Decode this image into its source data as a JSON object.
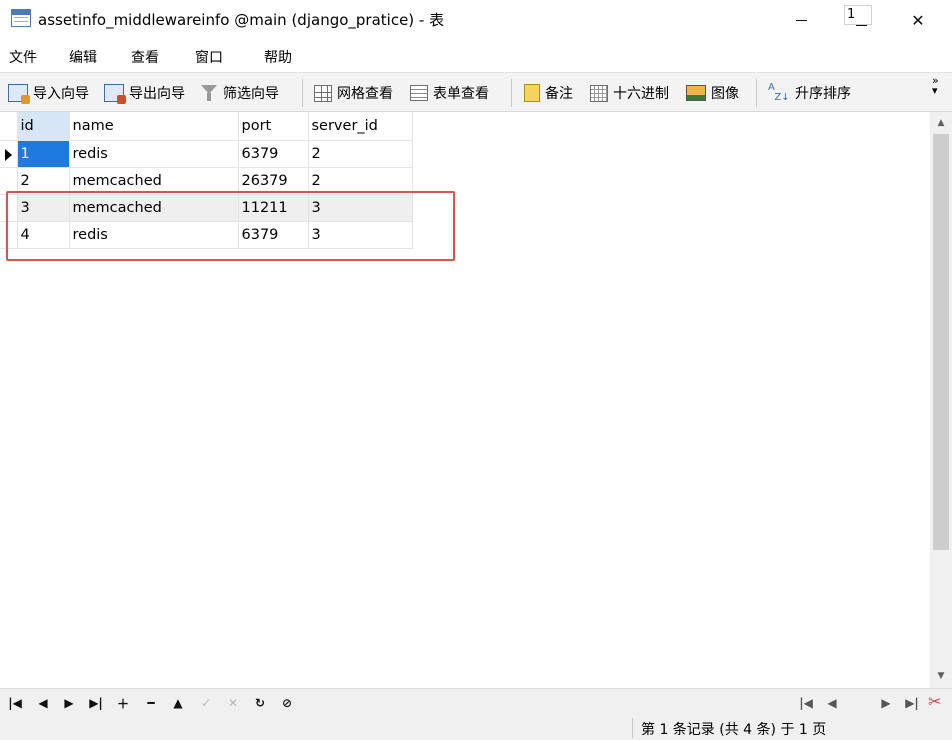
{
  "window": {
    "title": "assetinfo_middlewareinfo @main (django_pratice) - 表"
  },
  "menu": [
    "文件",
    "编辑",
    "查看",
    "窗口",
    "帮助"
  ],
  "toolbar": {
    "import_wizard": "导入向导",
    "export_wizard": "导出向导",
    "filter_wizard": "筛选向导",
    "grid_view": "网格查看",
    "form_view": "表单查看",
    "memo": "备注",
    "hex": "十六进制",
    "image": "图像",
    "sort_asc": "升序排序"
  },
  "table": {
    "columns": [
      "id",
      "name",
      "port",
      "server_id"
    ],
    "rows": [
      [
        "1",
        "redis",
        "6379",
        "2"
      ],
      [
        "2",
        "memcached",
        "26379",
        "2"
      ],
      [
        "3",
        "memcached",
        "11211",
        "3"
      ],
      [
        "4",
        "redis",
        "6379",
        "3"
      ]
    ]
  },
  "navigator": {
    "page_value": "1"
  },
  "status": {
    "text": "第 1 条记录 (共 4 条) 于 1 页"
  },
  "colors": {
    "selection": "#1f7ae0",
    "highlight_border": "#d9534f"
  }
}
